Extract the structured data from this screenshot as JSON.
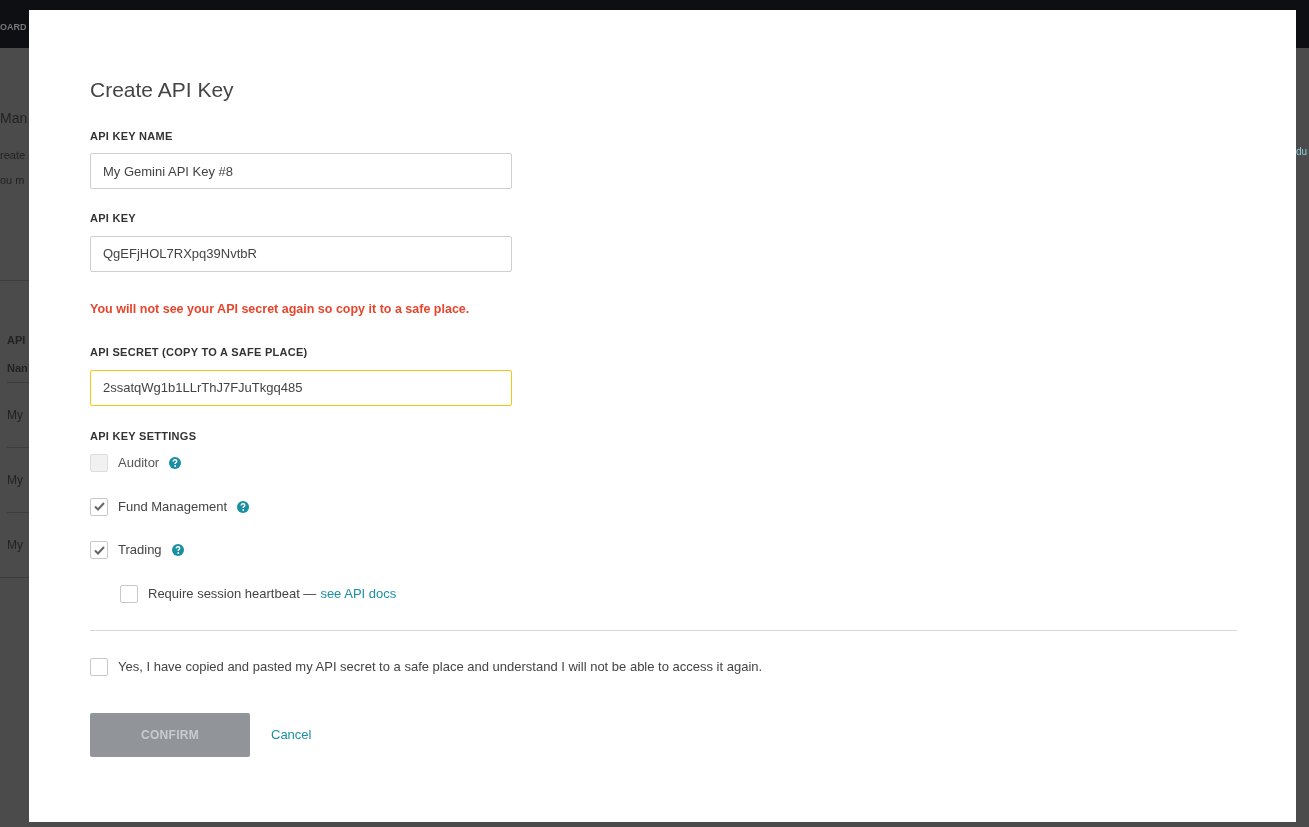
{
  "background": {
    "nav_fragment": "OARD",
    "heading_fragment": "Man",
    "text_fragments": [
      "reate",
      "ou m"
    ],
    "table_fragments": [
      {
        "kind": "header",
        "text": "API"
      },
      {
        "kind": "header",
        "text": "Nan"
      },
      {
        "kind": "row",
        "text": "My"
      },
      {
        "kind": "row",
        "text": "My"
      },
      {
        "kind": "row",
        "text": "My"
      }
    ],
    "right_fragment": "du"
  },
  "dialog": {
    "title": "Create API Key",
    "items": [
      {
        "kind": "field",
        "label": "API KEY NAME",
        "value": "My Gemini API Key #8",
        "focused": false
      },
      {
        "kind": "field",
        "label": "API KEY",
        "value": "QgEFjHOL7RXpq39NvtbR",
        "focused": false
      },
      {
        "kind": "warning",
        "text": "You will not see your API secret again so copy it to a safe place."
      },
      {
        "kind": "field",
        "label": "API SECRET (COPY TO A SAFE PLACE)",
        "value": "2ssatqWg1b1LLrThJ7FJuTkgq485",
        "focused": true
      }
    ],
    "settings": {
      "label": "API KEY SETTINGS",
      "options": [
        {
          "label": "Auditor",
          "checked": false,
          "disabled": true
        },
        {
          "label": "Fund Management",
          "checked": true,
          "disabled": false
        },
        {
          "label": "Trading",
          "checked": true,
          "disabled": false
        }
      ]
    },
    "heartbeat": {
      "label": "Require session heartbeat —",
      "link": "see API docs",
      "checked": false
    },
    "acknowledge": {
      "label": "Yes, I have copied and pasted my API secret to a safe place and understand I will not be able to access it again.",
      "checked": false
    },
    "confirm": {
      "label": "CONFIRM",
      "disabled": true
    },
    "cancel": "Cancel"
  }
}
